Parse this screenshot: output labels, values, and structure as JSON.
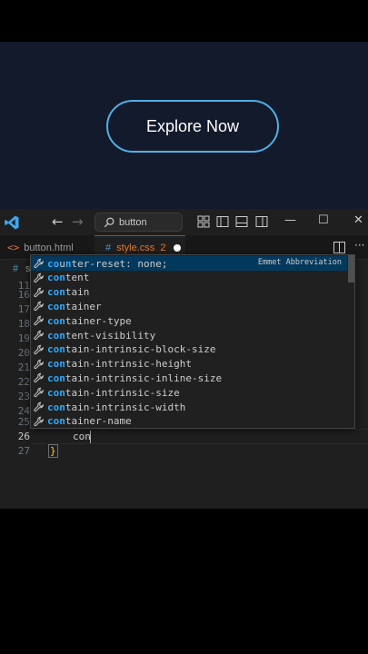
{
  "preview": {
    "button_label": "Explore Now"
  },
  "titlebar": {
    "search_text": "button",
    "nav_back": "←",
    "nav_forward": "→",
    "minimize": "—",
    "maximize": "☐",
    "close": "✕"
  },
  "tabs": [
    {
      "label": "button.html",
      "icon": "<>"
    },
    {
      "label": "style.css",
      "icon": "#",
      "badge": "2",
      "modified": true
    }
  ],
  "breadcrumb": {
    "icon": "#",
    "text": "s"
  },
  "editor": {
    "line_numbers": [
      "11",
      "16",
      "17",
      "18",
      "19",
      "20",
      "21",
      "22",
      "23",
      "24",
      "25",
      "26",
      "27"
    ],
    "current_line_text": "con",
    "closing_brace": "}"
  },
  "suggest": {
    "detail": "Emmet Abbreviation",
    "items": [
      {
        "pre": "",
        "match": "co",
        "mid1": "u",
        "match2": "n",
        "rest": "ter-reset: none;"
      },
      {
        "pre": "",
        "match": "con",
        "rest": "tent"
      },
      {
        "pre": "",
        "match": "con",
        "rest": "tain"
      },
      {
        "pre": "",
        "match": "con",
        "rest": "tainer"
      },
      {
        "pre": "",
        "match": "con",
        "rest": "tainer-type"
      },
      {
        "pre": "",
        "match": "con",
        "rest": "tent-visibility"
      },
      {
        "pre": "",
        "match": "con",
        "rest": "tain-intrinsic-block-size"
      },
      {
        "pre": "",
        "match": "con",
        "rest": "tain-intrinsic-height"
      },
      {
        "pre": "",
        "match": "con",
        "rest": "tain-intrinsic-inline-size"
      },
      {
        "pre": "",
        "match": "con",
        "rest": "tain-intrinsic-size"
      },
      {
        "pre": "",
        "match": "con",
        "rest": "tain-intrinsic-width"
      },
      {
        "pre": "",
        "match": "con",
        "rest": "tainer-name"
      }
    ]
  },
  "colors": {
    "accent": "#4fb0e6",
    "match_highlight": "#2aaaff",
    "selected_row": "#04395e",
    "tab_modified": "#e37933"
  }
}
